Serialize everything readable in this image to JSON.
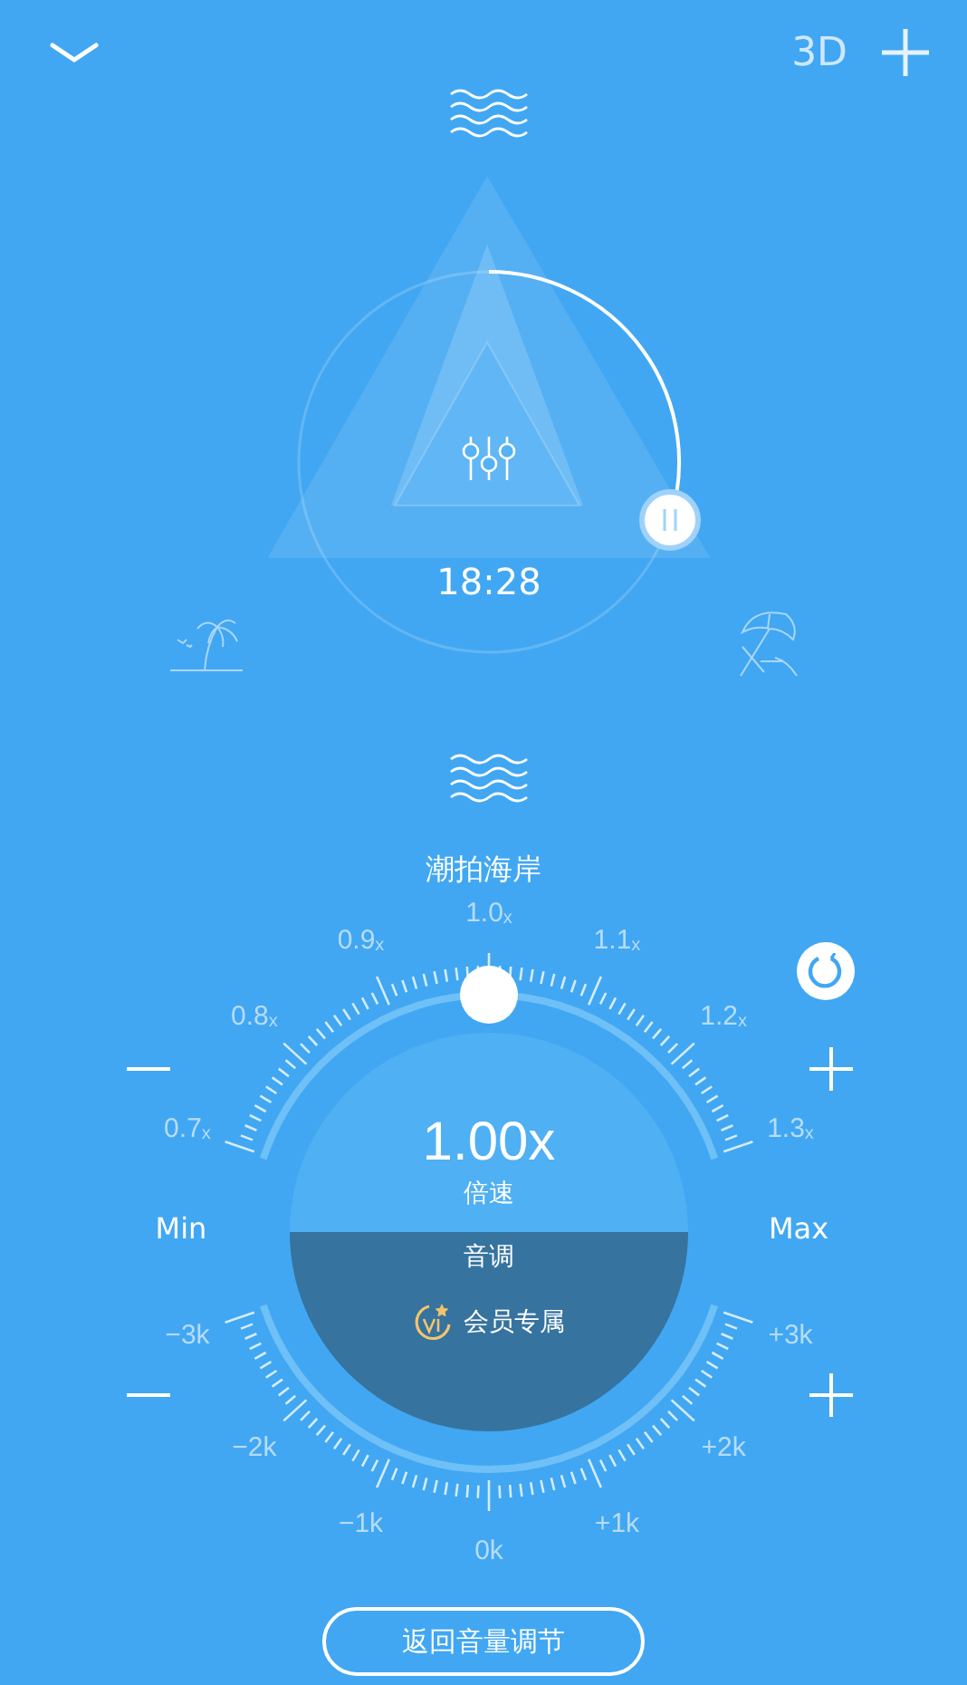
{
  "top_bar": {
    "mode_label": "3D"
  },
  "scene": {
    "time": "18:28",
    "playing": true
  },
  "title": "潮拍海岸",
  "speed": {
    "labels": [
      "0.7$_{x}$",
      "0.8$_{x}$",
      "0.9$_{x}$",
      "1.0$_{x}$",
      "1.1$_{x}$",
      "1.2$_{x}$",
      "1.3$_{x}$"
    ],
    "value": "1.00x",
    "caption": "倍速"
  },
  "pitch": {
    "labels": [
      "−3k",
      "−2k",
      "−1k",
      "0k",
      "+1k",
      "+2k",
      "+3k"
    ],
    "caption": "音调",
    "badge": "会员专属"
  },
  "range_labels": {
    "min": "Min",
    "max": "Max"
  },
  "back_button": "返回音量调节"
}
